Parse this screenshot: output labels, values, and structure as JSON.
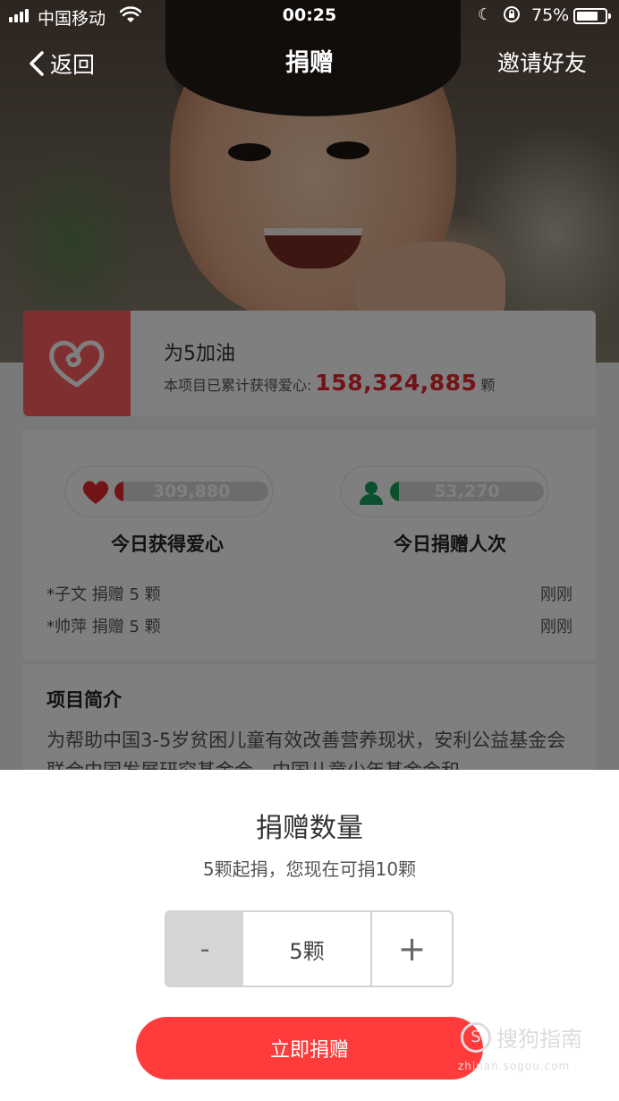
{
  "status_bar": {
    "carrier": "中国移动",
    "time": "00:25",
    "battery_percent": "75%",
    "battery_level": 0.75,
    "signal_icon": "signal-bars-icon",
    "wifi_icon": "wifi-icon"
  },
  "nav": {
    "back_label": "返回",
    "title": "捐赠",
    "invite_label": "邀请好友"
  },
  "project": {
    "title": "为5加油",
    "accumulated_prefix": "本项目已累计获得爱心:",
    "accumulated_value": "158,324,885",
    "accumulated_unit": "颗",
    "logo_icon": "heart-outline-icon"
  },
  "stats": {
    "hearts_today": {
      "value": "309,880",
      "label": "今日获得爱心",
      "fill": 0.06,
      "color": "#e5262f",
      "icon": "heart-icon"
    },
    "donors_today": {
      "value": "53,270",
      "label": "今日捐赠人次",
      "fill": 0.06,
      "color": "#1aa05a",
      "icon": "person-icon"
    }
  },
  "records": [
    {
      "text": "*子文 捐赠 5 颗",
      "time": "刚刚"
    },
    {
      "text": "*帅萍 捐赠 5 颗",
      "time": "刚刚"
    }
  ],
  "intro": {
    "title": "项目简介",
    "text": "为帮助中国3-5岁贫困儿童有效改善营养现状，安利公益基金会联合中国发展研究基金会、中国儿童少年基金会和"
  },
  "sheet": {
    "title": "捐赠数量",
    "subtitle": "5颗起捐，您现在可捐10颗",
    "minus_label": "-",
    "value": "5颗",
    "plus_label": "+",
    "donate_label": "立即捐赠"
  },
  "watermark": {
    "glyph": "S",
    "text": "搜狗指南",
    "url": "zhinan.sogou.com"
  }
}
